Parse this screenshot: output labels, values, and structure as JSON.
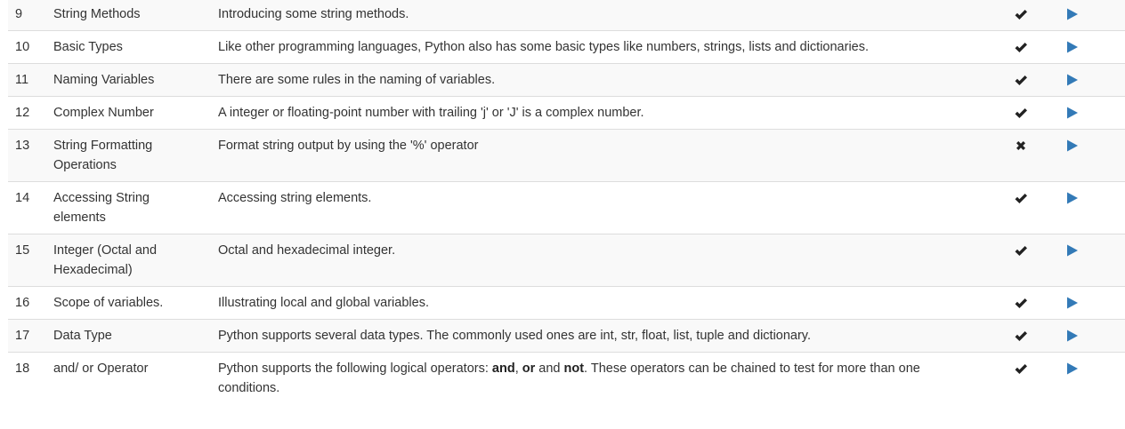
{
  "lessons": [
    {
      "number": "9",
      "title": "String Methods",
      "description": "Introducing some string methods.",
      "status": "done",
      "status_icon": "check-icon",
      "action_icon": "play-icon"
    },
    {
      "number": "10",
      "title": "Basic Types",
      "description": "Like other programming languages, Python also has some basic types like numbers, strings, lists and dictionaries.",
      "status": "done",
      "status_icon": "check-icon",
      "action_icon": "play-icon"
    },
    {
      "number": "11",
      "title": "Naming Variables",
      "description": "There are some rules in the naming of variables.",
      "status": "done",
      "status_icon": "check-icon",
      "action_icon": "play-icon"
    },
    {
      "number": "12",
      "title": "Complex Number",
      "description": "A integer or floating-point number with trailing 'j' or 'J' is a complex number.",
      "status": "done",
      "status_icon": "check-icon",
      "action_icon": "play-icon"
    },
    {
      "number": "13",
      "title": "String Formatting Operations",
      "description": "Format string output by using the '%' operator",
      "status": "not-done",
      "status_icon": "cross-icon",
      "action_icon": "play-icon"
    },
    {
      "number": "14",
      "title": "Accessing String elements",
      "description": "Accessing string elements.",
      "status": "done",
      "status_icon": "check-icon",
      "action_icon": "play-icon"
    },
    {
      "number": "15",
      "title": "Integer (Octal and Hexadecimal)",
      "description": "Octal and hexadecimal integer.",
      "status": "done",
      "status_icon": "check-icon",
      "action_icon": "play-icon"
    },
    {
      "number": "16",
      "title": "Scope of variables.",
      "description": "Illustrating local and global variables.",
      "status": "done",
      "status_icon": "check-icon",
      "action_icon": "play-icon"
    },
    {
      "number": "17",
      "title": "Data Type",
      "description": "Python supports several data types. The commonly used ones are int, str, float, list, tuple and dictionary.",
      "status": "done",
      "status_icon": "check-icon",
      "action_icon": "play-icon"
    },
    {
      "number": "18",
      "title": "and/ or Operator",
      "description_parts": [
        {
          "text": "Python supports the following logical operators: ",
          "bold": false
        },
        {
          "text": "and",
          "bold": true
        },
        {
          "text": ", ",
          "bold": false
        },
        {
          "text": "or",
          "bold": true
        },
        {
          "text": " and ",
          "bold": false
        },
        {
          "text": "not",
          "bold": true
        },
        {
          "text": ". These operators can be chained to test for more than one conditions.",
          "bold": false
        }
      ],
      "status": "done",
      "status_icon": "check-icon",
      "action_icon": "play-icon"
    }
  ],
  "colors": {
    "text": "#333333",
    "icon_dark": "#222222",
    "play_blue": "#337ab7",
    "row_stripe": "#f9f9f9",
    "border": "#dddddd"
  }
}
